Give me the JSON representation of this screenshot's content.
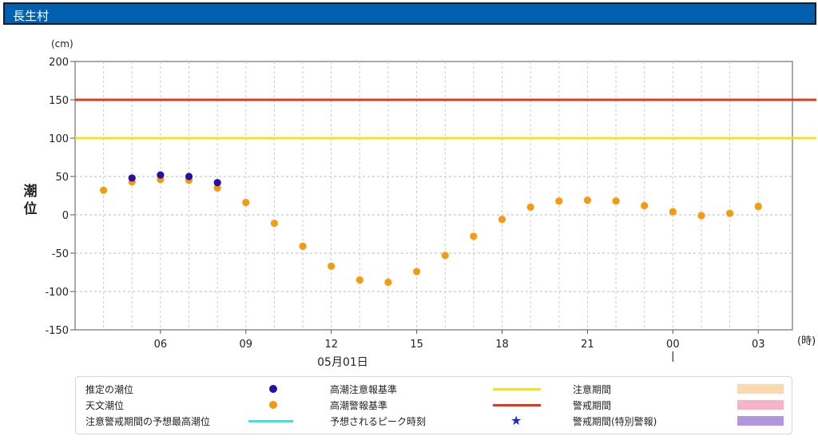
{
  "header": {
    "title": "長生村"
  },
  "chart_data": {
    "type": "scatter",
    "ylabel": "潮位",
    "yunit": "(cm)",
    "xunit": "(時)",
    "ylim": [
      -150,
      200
    ],
    "yticks": [
      200,
      150,
      100,
      50,
      0,
      -50,
      -100,
      -150
    ],
    "xticks": [
      "06",
      "09",
      "12",
      "15",
      "18",
      "21",
      "00",
      "03"
    ],
    "date_label": "05月01日",
    "grid": true,
    "x_hours": [
      4,
      5,
      6,
      7,
      8,
      9,
      10,
      11,
      12,
      13,
      14,
      15,
      16,
      17,
      18,
      19,
      20,
      21,
      22,
      23,
      24,
      25,
      26,
      27
    ],
    "series": [
      {
        "name": "推定の潮位",
        "color": "#2b0fa0",
        "x": [
          5,
          6,
          7,
          8
        ],
        "values": [
          48,
          52,
          50,
          42
        ]
      },
      {
        "name": "天文潮位",
        "color": "#f39c12",
        "x": [
          4,
          5,
          6,
          7,
          8,
          9,
          10,
          11,
          12,
          13,
          14,
          15,
          16,
          17,
          18,
          19,
          20,
          21,
          22,
          23,
          24,
          25,
          26,
          27
        ],
        "values": [
          32,
          43,
          46,
          45,
          35,
          16,
          -11,
          -41,
          -67,
          -85,
          -88,
          -74,
          -53,
          -28,
          -6,
          10,
          18,
          19,
          18,
          12,
          4,
          -1,
          2,
          11
        ]
      }
    ],
    "reference_lines": [
      {
        "name": "高潮注意報基準",
        "value": 100,
        "color": "#f0e422"
      },
      {
        "name": "高潮警報基準",
        "value": 150,
        "color": "#e03a1e"
      }
    ]
  },
  "legend": {
    "items": [
      {
        "label": "推定の潮位",
        "kind": "dot",
        "color": "#2b0fa0"
      },
      {
        "label": "高潮注意報基準",
        "kind": "line",
        "color": "#f0e422"
      },
      {
        "label": "注意期間",
        "kind": "rect",
        "color": "#fad9b0"
      },
      {
        "label": "天文潮位",
        "kind": "dot",
        "color": "#f39c12"
      },
      {
        "label": "高潮警報基準",
        "kind": "line",
        "color": "#e03a1e"
      },
      {
        "label": "警戒期間",
        "kind": "rect",
        "color": "#f7b3c8"
      },
      {
        "label": "注意警戒期間の予想最高潮位",
        "kind": "line",
        "color": "#3ee0e0"
      },
      {
        "label": "予想されるピーク時刻",
        "kind": "star",
        "color": "#1a2ad0"
      },
      {
        "label": "警戒期間(特別警報)",
        "kind": "rect",
        "color": "#b096dc"
      }
    ]
  }
}
